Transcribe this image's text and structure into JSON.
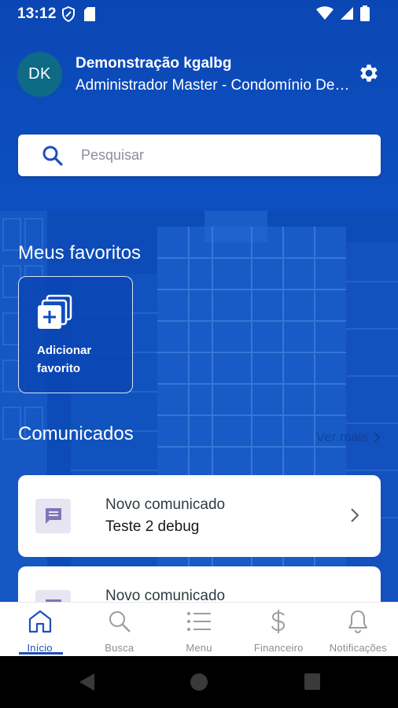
{
  "status_bar": {
    "time": "13:12"
  },
  "user": {
    "initials": "DK",
    "name": "Demonstração kgalbg",
    "role": "Administrador Master - Condomínio Demonstração"
  },
  "search": {
    "placeholder": "Pesquisar"
  },
  "favorites": {
    "title": "Meus favoritos",
    "add_label": "Adicionar favorito"
  },
  "announcements": {
    "title": "Comunicados",
    "see_more": "Ver mais",
    "items": [
      {
        "type": "Novo comunicado",
        "title": "Teste 2 debug"
      },
      {
        "type": "Novo comunicado",
        "title": ""
      }
    ]
  },
  "bottom_nav": {
    "items": [
      {
        "label": "Início",
        "icon": "home-icon",
        "active": true
      },
      {
        "label": "Busca",
        "icon": "search-icon",
        "active": false
      },
      {
        "label": "Menu",
        "icon": "menu-icon",
        "active": false
      },
      {
        "label": "Financeiro",
        "icon": "dollar-icon",
        "active": false
      },
      {
        "label": "Notificações",
        "icon": "bell-icon",
        "active": false
      }
    ]
  },
  "colors": {
    "primary": "#0d4fc0",
    "active_nav": "#1f4fb8",
    "avatar": "#0f6a86"
  }
}
